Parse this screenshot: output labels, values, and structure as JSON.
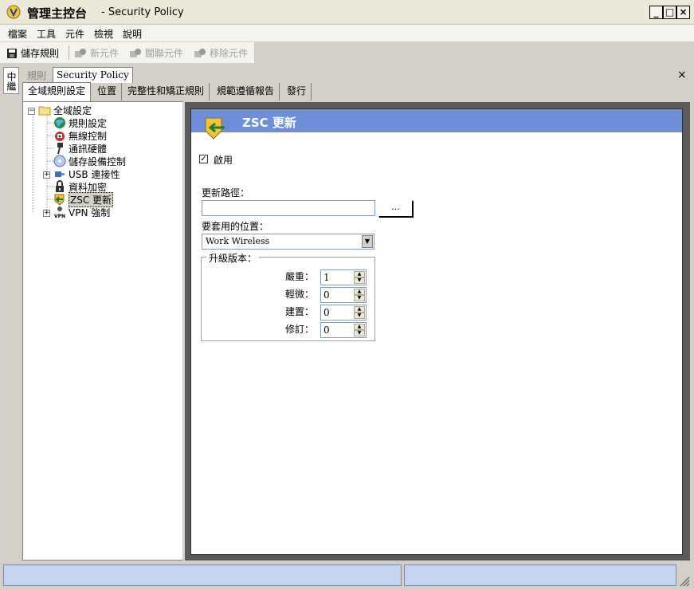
{
  "window": {
    "title_main": "管理主控台",
    "title_sub": "- Security Policy",
    "min_glyph": "_",
    "max_glyph": "□",
    "close_glyph": "×"
  },
  "menu": [
    "檔案",
    "工具",
    "元件",
    "檢視",
    "說明"
  ],
  "toolbar": {
    "save": "儲存規則",
    "new_component": "新元件",
    "link_component": "關聯元件",
    "remove_component": "移除元件"
  },
  "side_tab": "中繼",
  "strip": {
    "label": "規則",
    "tab": "Security Policy",
    "close": "×"
  },
  "tabs": [
    "全域規則設定",
    "位置",
    "完整性和矯正規則",
    "規範遵循報告",
    "發行"
  ],
  "tree": {
    "root": "全域設定",
    "items": [
      "規則設定",
      "無線控制",
      "通訊硬體",
      "儲存設備控制",
      "USB 連接性",
      "資料加密",
      "ZSC 更新",
      "VPN 強制"
    ],
    "expand_glyph": "+",
    "collapse_glyph": "−"
  },
  "detail": {
    "title": "ZSC 更新",
    "enable_label": "啟用",
    "enable_checked": true,
    "check_glyph": "✓",
    "path_label": "更新路徑：",
    "path_value": "",
    "browse": "...",
    "location_label": "要套用的位置：",
    "location_value": "Work Wireless",
    "version_group": "升級版本：",
    "version_fields": [
      {
        "label": "嚴重：",
        "value": "1"
      },
      {
        "label": "輕微：",
        "value": "0"
      },
      {
        "label": "建置：",
        "value": "0"
      },
      {
        "label": "修訂：",
        "value": "0"
      }
    ]
  },
  "colors": {
    "header_blue": "#6f8ed8",
    "status_blue": "#c5d4f2"
  }
}
